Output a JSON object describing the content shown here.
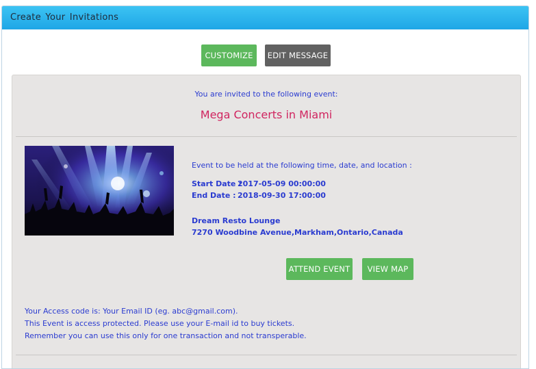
{
  "panel": {
    "title": "Create Your Invitations"
  },
  "toolbar": {
    "customize_label": "CUSTOMIZE",
    "edit_message_label": "EDIT MESSAGE"
  },
  "invitation": {
    "intro": "You are invited to the following event:",
    "event_title": "Mega Concerts in Miami",
    "details_intro": "Event to be held at the following time, date, and location :",
    "start_label": "Start Date :",
    "start_value": "2017-05-09 00:00:00",
    "end_label": "End Date :",
    "end_value": "2018-09-30 17:00:00",
    "venue": "Dream Resto Lounge",
    "address": "7270 Woodbine Avenue,Markham,Ontario,Canada",
    "attend_label": "ATTEND EVENT",
    "map_label": "VIEW MAP",
    "access_code": "Your Access code is: Your Email ID (eg. abc@gmail.com).",
    "protected_note": "This Event is access protected. Please use your E-mail id to buy tickets.",
    "transfer_note": "Remember you can use this only for one transaction and not transperable."
  },
  "colors": {
    "header": "#1ea6e6",
    "green_button": "#5cb85c",
    "dark_button": "#616161",
    "title_accent": "#d0245f",
    "text_blue": "#2a3bd0"
  }
}
